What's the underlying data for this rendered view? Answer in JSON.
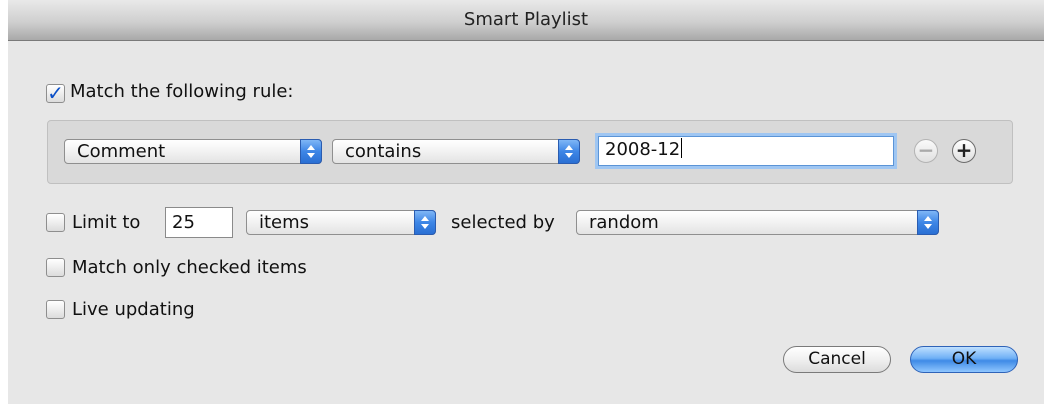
{
  "window": {
    "title": "Smart Playlist"
  },
  "match_rule": {
    "checked": true,
    "label": "Match the following rule:"
  },
  "rule": {
    "field": "Comment",
    "operator": "contains",
    "value": "2008-12",
    "remove_icon": "minus-circle-icon",
    "add_icon": "plus-circle-icon"
  },
  "limit": {
    "checked": false,
    "label": "Limit to",
    "count": "25",
    "unit": "items",
    "selected_by_label": "selected by",
    "selected_by": "random"
  },
  "match_checked": {
    "checked": false,
    "label": "Match only checked items"
  },
  "live_updating": {
    "checked": false,
    "label": "Live updating"
  },
  "buttons": {
    "cancel": "Cancel",
    "ok": "OK"
  },
  "colors": {
    "accent": "#3f8ae6",
    "checkmark": "#0b4fc7"
  }
}
